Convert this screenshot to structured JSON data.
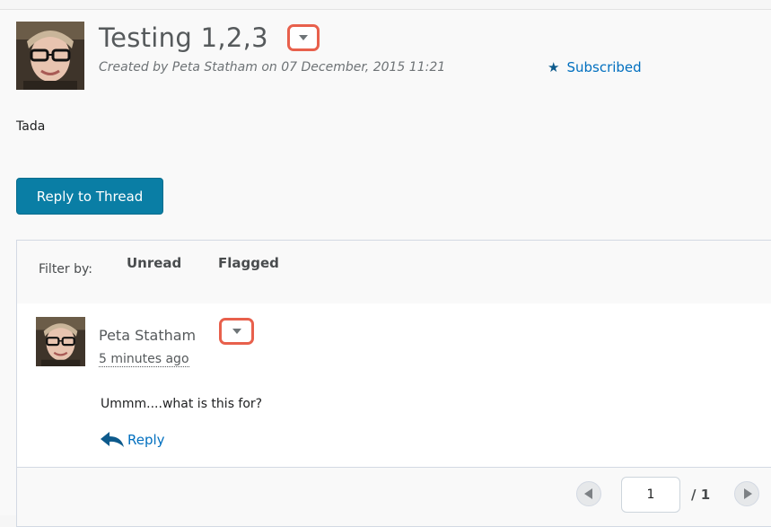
{
  "topic": {
    "title": "Testing 1,2,3",
    "created": "Created by Peta Statham on 07 December, 2015 11:21",
    "subscribed": "Subscribed",
    "body": "Tada",
    "reply_button": "Reply to Thread"
  },
  "filter": {
    "label": "Filter by:",
    "unread": "Unread",
    "flagged": "Flagged"
  },
  "post": {
    "author": "Peta Statham",
    "time": "5 minutes ago",
    "text": "Ummm....what is this for?",
    "reply": "Reply"
  },
  "pager": {
    "page": "1",
    "total": "/ 1"
  },
  "colors": {
    "accent": "#0a7ea5",
    "link": "#006fbf",
    "highlight": "#e8604c"
  },
  "icons": {
    "subscribe": "star-icon",
    "reply": "reply-arrow-icon",
    "context_menu": "chevron-down-icon"
  }
}
